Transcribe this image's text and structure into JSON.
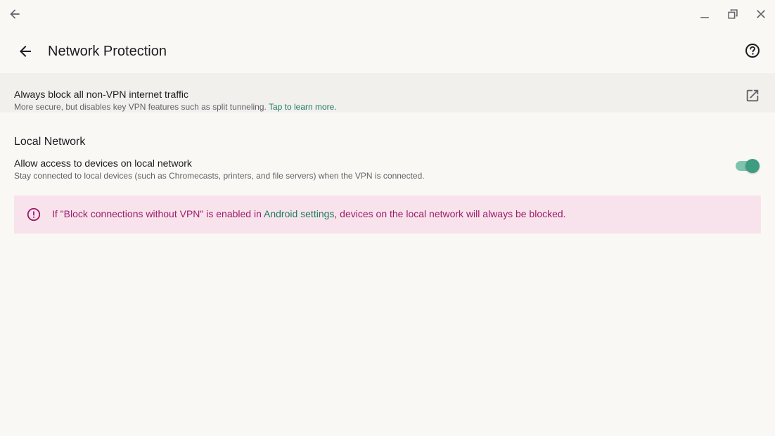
{
  "titlebar": {
    "back_icon": "arrow-left-icon",
    "minimize_icon": "minimize-icon",
    "maximize_icon": "restore-icon",
    "close_icon": "close-icon"
  },
  "appbar": {
    "title": "Network Protection",
    "back_icon": "arrow-left-icon",
    "help_icon": "help-circle-icon"
  },
  "block_all": {
    "title": "Always block all non-VPN internet traffic",
    "subtitle": "More secure, but disables key VPN features such as split tunneling. ",
    "link": "Tap to learn more.",
    "icon": "external-link-icon"
  },
  "local_network": {
    "section_title": "Local Network",
    "title": "Allow access to devices on local network",
    "subtitle": "Stay connected to local devices (such as Chromecasts, printers, and file servers) when the VPN is connected.",
    "toggle_on": true
  },
  "warning": {
    "icon": "alert-circle-icon",
    "text_before": "If \"Block connections without VPN\" is enabled in ",
    "link": "Android settings",
    "text_after": ", devices on the local network will always be blocked."
  },
  "colors": {
    "background": "#faf8f5",
    "row_highlight": "#f2f0ed",
    "accent": "#1e7a63",
    "switch_thumb": "#3e9c80",
    "switch_track": "#7cc4ae",
    "warning_bg": "#f8e3ec",
    "warning_text": "#9c1b6a"
  }
}
